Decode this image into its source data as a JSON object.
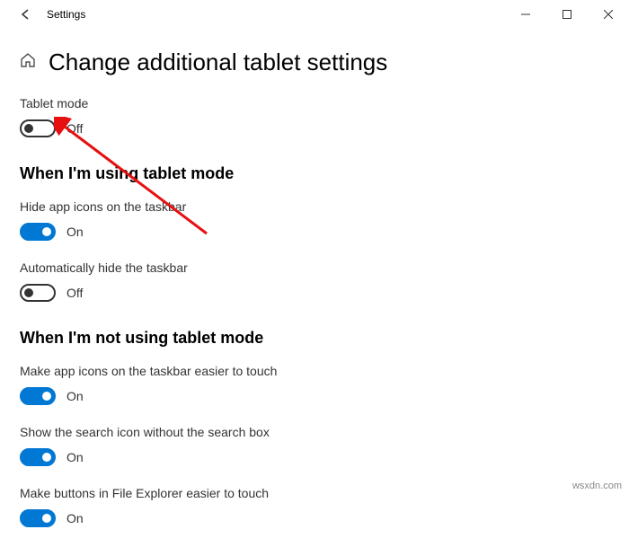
{
  "titlebar": {
    "app_title": "Settings"
  },
  "page": {
    "heading": "Change additional tablet settings"
  },
  "tablet_mode": {
    "label": "Tablet mode",
    "status": "Off"
  },
  "section_using": {
    "heading": "When I'm using tablet mode",
    "hide_icons": {
      "label": "Hide app icons on the taskbar",
      "status": "On"
    },
    "auto_hide": {
      "label": "Automatically hide the taskbar",
      "status": "Off"
    }
  },
  "section_not_using": {
    "heading": "When I'm not using tablet mode",
    "easier_icons": {
      "label": "Make app icons on the taskbar easier to touch",
      "status": "On"
    },
    "search_icon": {
      "label": "Show the search icon without the search box",
      "status": "On"
    },
    "file_explorer": {
      "label": "Make buttons in File Explorer easier to touch",
      "status": "On"
    }
  },
  "watermark": "wsxdn.com"
}
